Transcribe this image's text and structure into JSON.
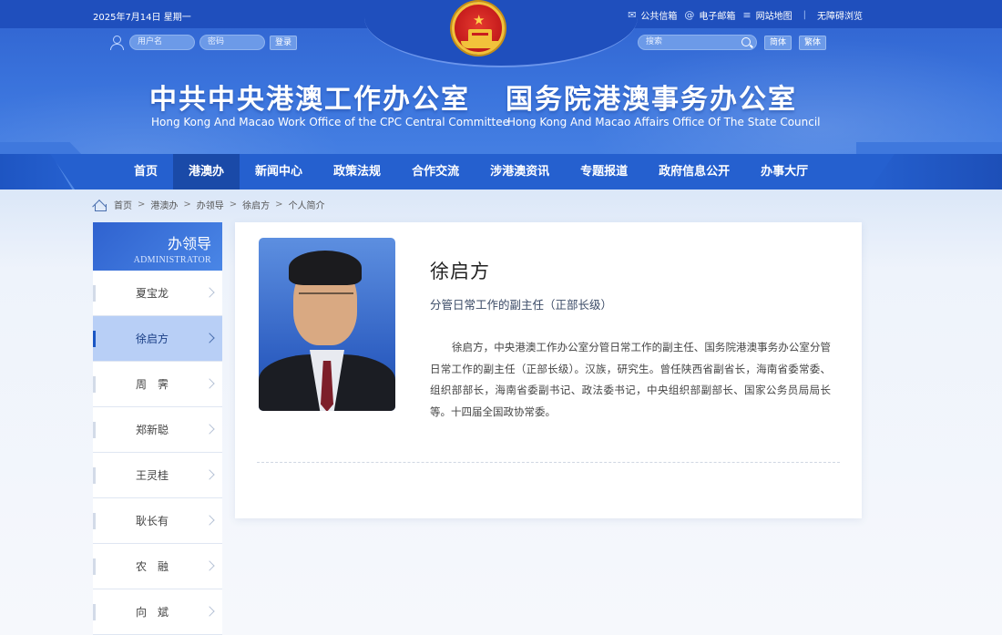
{
  "top_bar": {
    "date": "2025年7月14日 星期一",
    "links": [
      {
        "label": "公共信箱",
        "icon": "mail-icon"
      },
      {
        "label": "电子邮箱",
        "icon": "at-icon"
      },
      {
        "label": "网站地图",
        "icon": "list-icon"
      },
      {
        "label": "无障碍浏览"
      }
    ]
  },
  "login": {
    "username_placeholder": "用户名",
    "password_placeholder": "密码",
    "button": "登录"
  },
  "search": {
    "placeholder": "搜索",
    "simplified": "简体",
    "traditional": "繁体"
  },
  "titles": {
    "left_cn": "中共中央港澳工作办公室",
    "left_en": "Hong Kong And Macao Work Office of the CPC Central Committee",
    "right_cn": "国务院港澳事务办公室",
    "right_en": "Hong Kong And Macao Affairs Office Of The State Council"
  },
  "nav": {
    "items": [
      "首页",
      "港澳办",
      "新闻中心",
      "政策法规",
      "合作交流",
      "涉港澳资讯",
      "专题报道",
      "政府信息公开",
      "办事大厅"
    ],
    "active_index": 1
  },
  "breadcrumb": [
    "首页",
    "港澳办",
    "办领导",
    "徐启方",
    "个人简介"
  ],
  "sidebar": {
    "title_cn": "办领导",
    "title_en": "ADMINISTRATOR",
    "items": [
      "夏宝龙",
      "徐启方",
      "周　霁",
      "郑新聪",
      "王灵桂",
      "耿长有",
      "农　融",
      "向　斌"
    ],
    "active_index": 1
  },
  "profile": {
    "name": "徐启方",
    "position": "分管日常工作的副主任（正部长级）",
    "bio": "徐启方，中央港澳工作办公室分管日常工作的副主任、国务院港澳事务办公室分管日常工作的副主任（正部长级）。汉族，研究生。曾任陕西省副省长，海南省委常委、组织部部长，海南省委副书记、政法委书记，中央组织部副部长、国家公务员局局长等。十四届全国政协常委。"
  },
  "colors": {
    "header_blue": "#2f62cf",
    "nav_blue": "#2560cf",
    "nav_active": "#1a4aa8",
    "sidebar_active": "#b8cff6"
  }
}
